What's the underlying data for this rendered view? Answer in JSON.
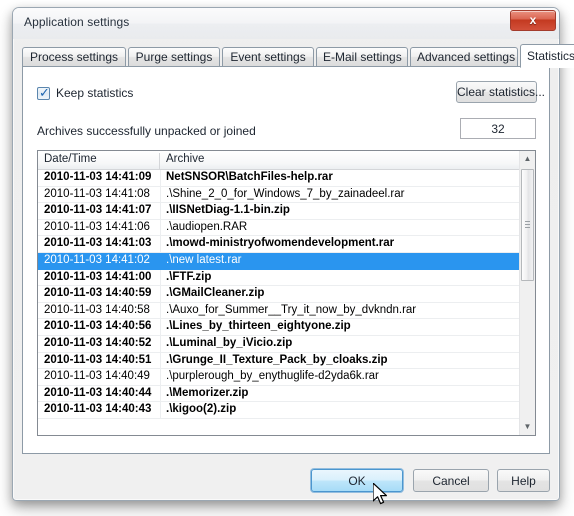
{
  "window": {
    "title": "Application settings",
    "close_label": "x",
    "close_icon": "close-icon"
  },
  "tabs": [
    {
      "label": "Process settings",
      "selected": false
    },
    {
      "label": "Purge settings",
      "selected": false
    },
    {
      "label": "Event settings",
      "selected": false
    },
    {
      "label": "E-Mail settings",
      "selected": false
    },
    {
      "label": "Advanced settings",
      "selected": false
    },
    {
      "label": "Statistics",
      "selected": true
    }
  ],
  "statistics": {
    "keep_statistics_label": "Keep statistics",
    "keep_statistics_checked": true,
    "clear_statistics_label": "Clear statistics...",
    "archives_label": "Archives successfully unpacked or joined",
    "archives_count": "32"
  },
  "list": {
    "columns": [
      "Date/Time",
      "Archive"
    ],
    "selected_index": 5,
    "rows": [
      {
        "date": "2010-11-03 14:41:09",
        "archive": "NetSNSOR\\BatchFiles-help.rar",
        "bold": true
      },
      {
        "date": "2010-11-03 14:41:08",
        "archive": ".\\Shine_2_0_for_Windows_7_by_zainadeel.rar",
        "bold": false
      },
      {
        "date": "2010-11-03 14:41:07",
        "archive": ".\\IISNetDiag-1.1-bin.zip",
        "bold": true
      },
      {
        "date": "2010-11-03 14:41:06",
        "archive": ".\\audiopen.RAR",
        "bold": false
      },
      {
        "date": "2010-11-03 14:41:03",
        "archive": ".\\mowd-ministryofwomendevelopment.rar",
        "bold": true
      },
      {
        "date": "2010-11-03 14:41:02",
        "archive": ".\\new latest.rar",
        "bold": false
      },
      {
        "date": "2010-11-03 14:41:00",
        "archive": ".\\FTF.zip",
        "bold": true
      },
      {
        "date": "2010-11-03 14:40:59",
        "archive": ".\\GMailCleaner.zip",
        "bold": true
      },
      {
        "date": "2010-11-03 14:40:58",
        "archive": ".\\Auxo_for_Summer__Try_it_now_by_dvkndn.rar",
        "bold": false
      },
      {
        "date": "2010-11-03 14:40:56",
        "archive": ".\\Lines_by_thirteen_eightyone.zip",
        "bold": true
      },
      {
        "date": "2010-11-03 14:40:52",
        "archive": ".\\Luminal_by_iVicio.zip",
        "bold": true
      },
      {
        "date": "2010-11-03 14:40:51",
        "archive": ".\\Grunge_II_Texture_Pack_by_cloaks.zip",
        "bold": true
      },
      {
        "date": "2010-11-03 14:40:49",
        "archive": ".\\purplerough_by_enythuglife-d2yda6k.rar",
        "bold": false
      },
      {
        "date": "2010-11-03 14:40:44",
        "archive": ".\\Memorizer.zip",
        "bold": true
      },
      {
        "date": "2010-11-03 14:40:43",
        "archive": ".\\kigoo(2).zip",
        "bold": true
      }
    ]
  },
  "scrollbar": {
    "up_arrow": "▲",
    "down_arrow": "▼"
  },
  "footer": {
    "ok_label": "OK",
    "cancel_label": "Cancel",
    "help_label": "Help"
  },
  "colors": {
    "selection": "#2a95ef",
    "close_button": "#c33920",
    "hover_button": "#bee6fa"
  }
}
